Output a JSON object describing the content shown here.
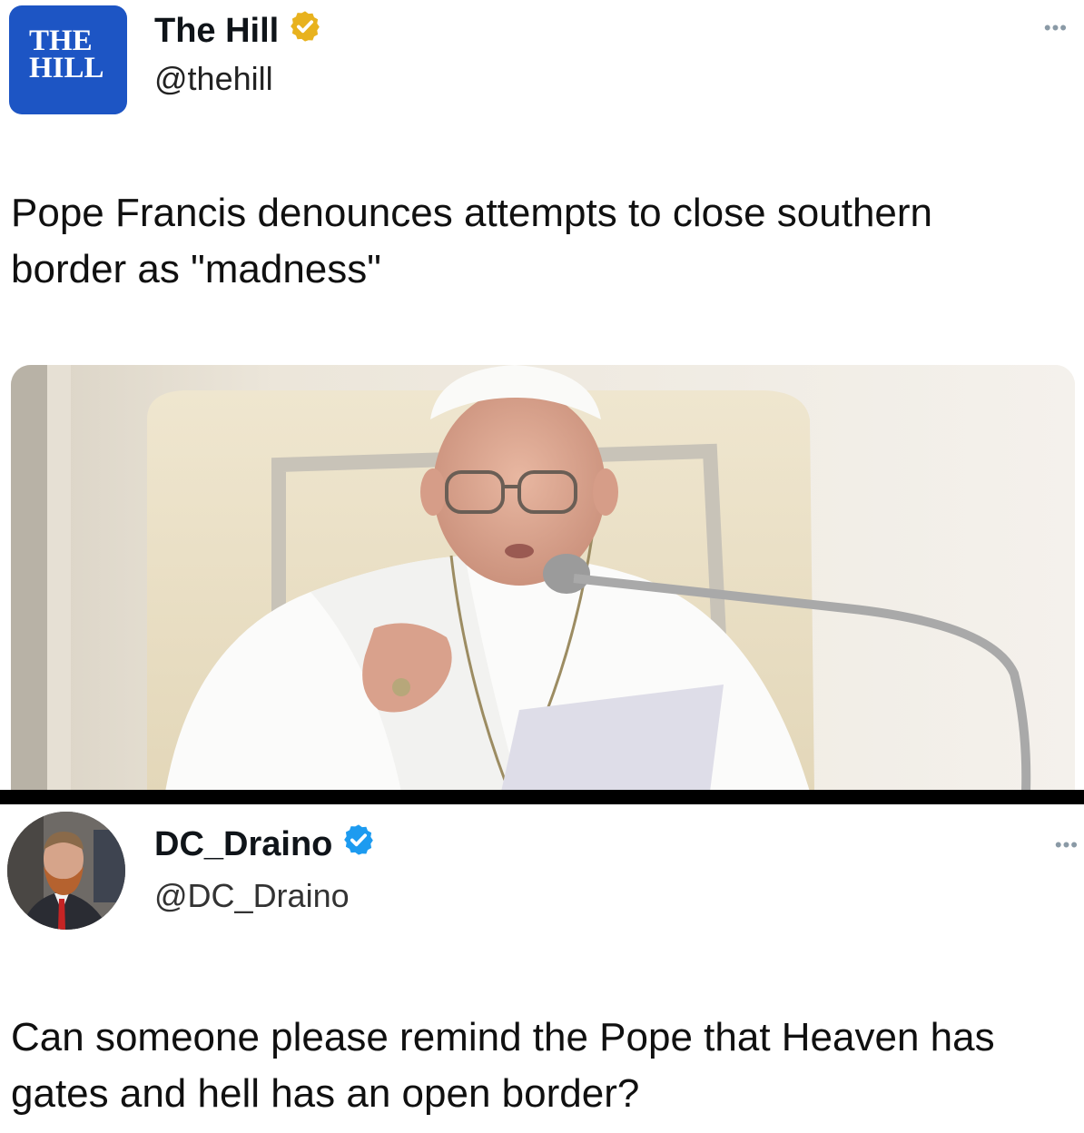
{
  "tweet1": {
    "logo_line1": "THE",
    "logo_line2": "HILL",
    "display_name": "The Hill",
    "handle": "@thehill",
    "more": "•••",
    "text": "Pope Francis denounces attempts to close southern border as \"madness\"",
    "verified_badge": "gold-verified-icon",
    "badge_color": "#e8b21e"
  },
  "tweet2": {
    "display_name": "DC_Draino",
    "handle": "@DC_Draino",
    "more": "•••",
    "text": "Can someone please remind the Pope that Heaven has gates and hell has an open border?",
    "verified_badge": "blue-verified-icon",
    "badge_color": "#1d9bf0"
  },
  "colors": {
    "hill_blue": "#1d55c4",
    "divider": "#000000"
  }
}
